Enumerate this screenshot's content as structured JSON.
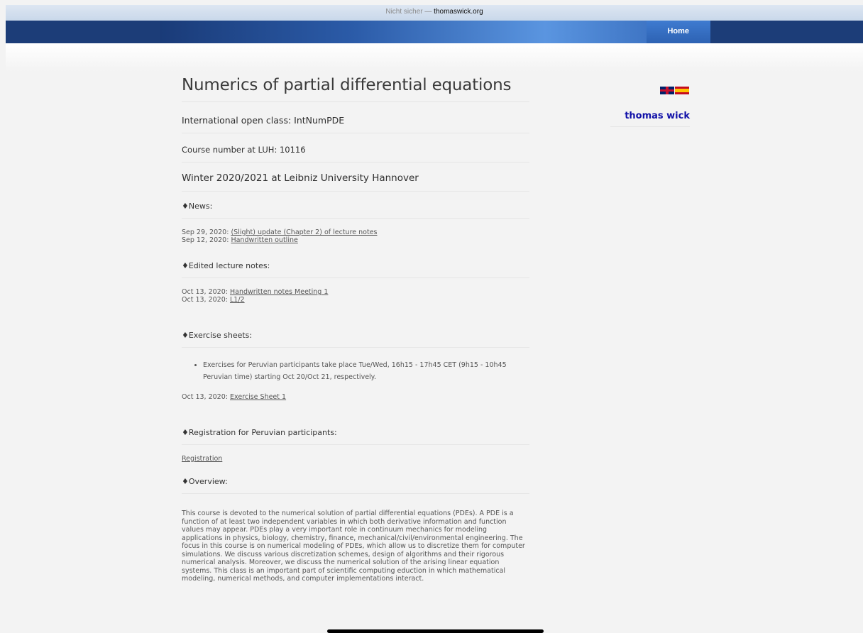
{
  "browser": {
    "security": "Nicht sicher",
    "separator": " — ",
    "domain": "thomaswick.org"
  },
  "nav": {
    "home": "Home"
  },
  "sidebar": {
    "author": "thomas wick",
    "languages": [
      "english-flag",
      "spanish-flag"
    ]
  },
  "page": {
    "title": "Numerics of partial differential equations",
    "subtitle": "International open class: IntNumPDE",
    "course_number": "Course number at LUH: 10116",
    "semester": "Winter 2020/2021 at Leibniz University Hannover"
  },
  "news": {
    "heading": "♦News:",
    "items": [
      {
        "date": "Sep 29, 2020: ",
        "link": "(Slight) update (Chapter 2) of lecture notes"
      },
      {
        "date": "Sep 12, 2020: ",
        "link": "Handwritten outline"
      }
    ]
  },
  "lecture_notes": {
    "heading": "♦Edited lecture notes:",
    "items": [
      {
        "date": "Oct 13, 2020: ",
        "link": "Handwritten notes Meeting 1"
      },
      {
        "date": "Oct 13, 2020: ",
        "link": "L1/2"
      }
    ]
  },
  "exercises": {
    "heading": "♦Exercise sheets:",
    "bullet": "Exercises for Peruvian participants take place Tue/Wed, 16h15 - 17h45 CET (9h15 - 10h45 Peruvian time) starting Oct 20/Oct 21, respectively.",
    "item": {
      "date": "Oct 13, 2020: ",
      "link": "Exercise Sheet 1"
    }
  },
  "registration": {
    "heading": "♦Registration for Peruvian participants:",
    "link": "Registration"
  },
  "overview": {
    "heading": "♦Overview:",
    "text": "This course is devoted to the numerical solution of partial differential equations (PDEs). A PDE is a function of at least two independent variables in which both derivative information and function values may appear. PDEs play a very important role in continuum mechanics for modeling applications in physics, biology, chemistry, finance, mechanical/civil/environmental engineering. The focus in this course is on numerical modeling of PDEs, which allow us to discretize them for computer simulations. We discuss various discretization schemes, design of algorithms and their rigorous numerical analysis. Moreover, we discuss the numerical solution of the arising linear equation systems. This class is an important part of scientific computing eduction in which mathematical modeling, numerical methods, and computer implementations interact."
  }
}
